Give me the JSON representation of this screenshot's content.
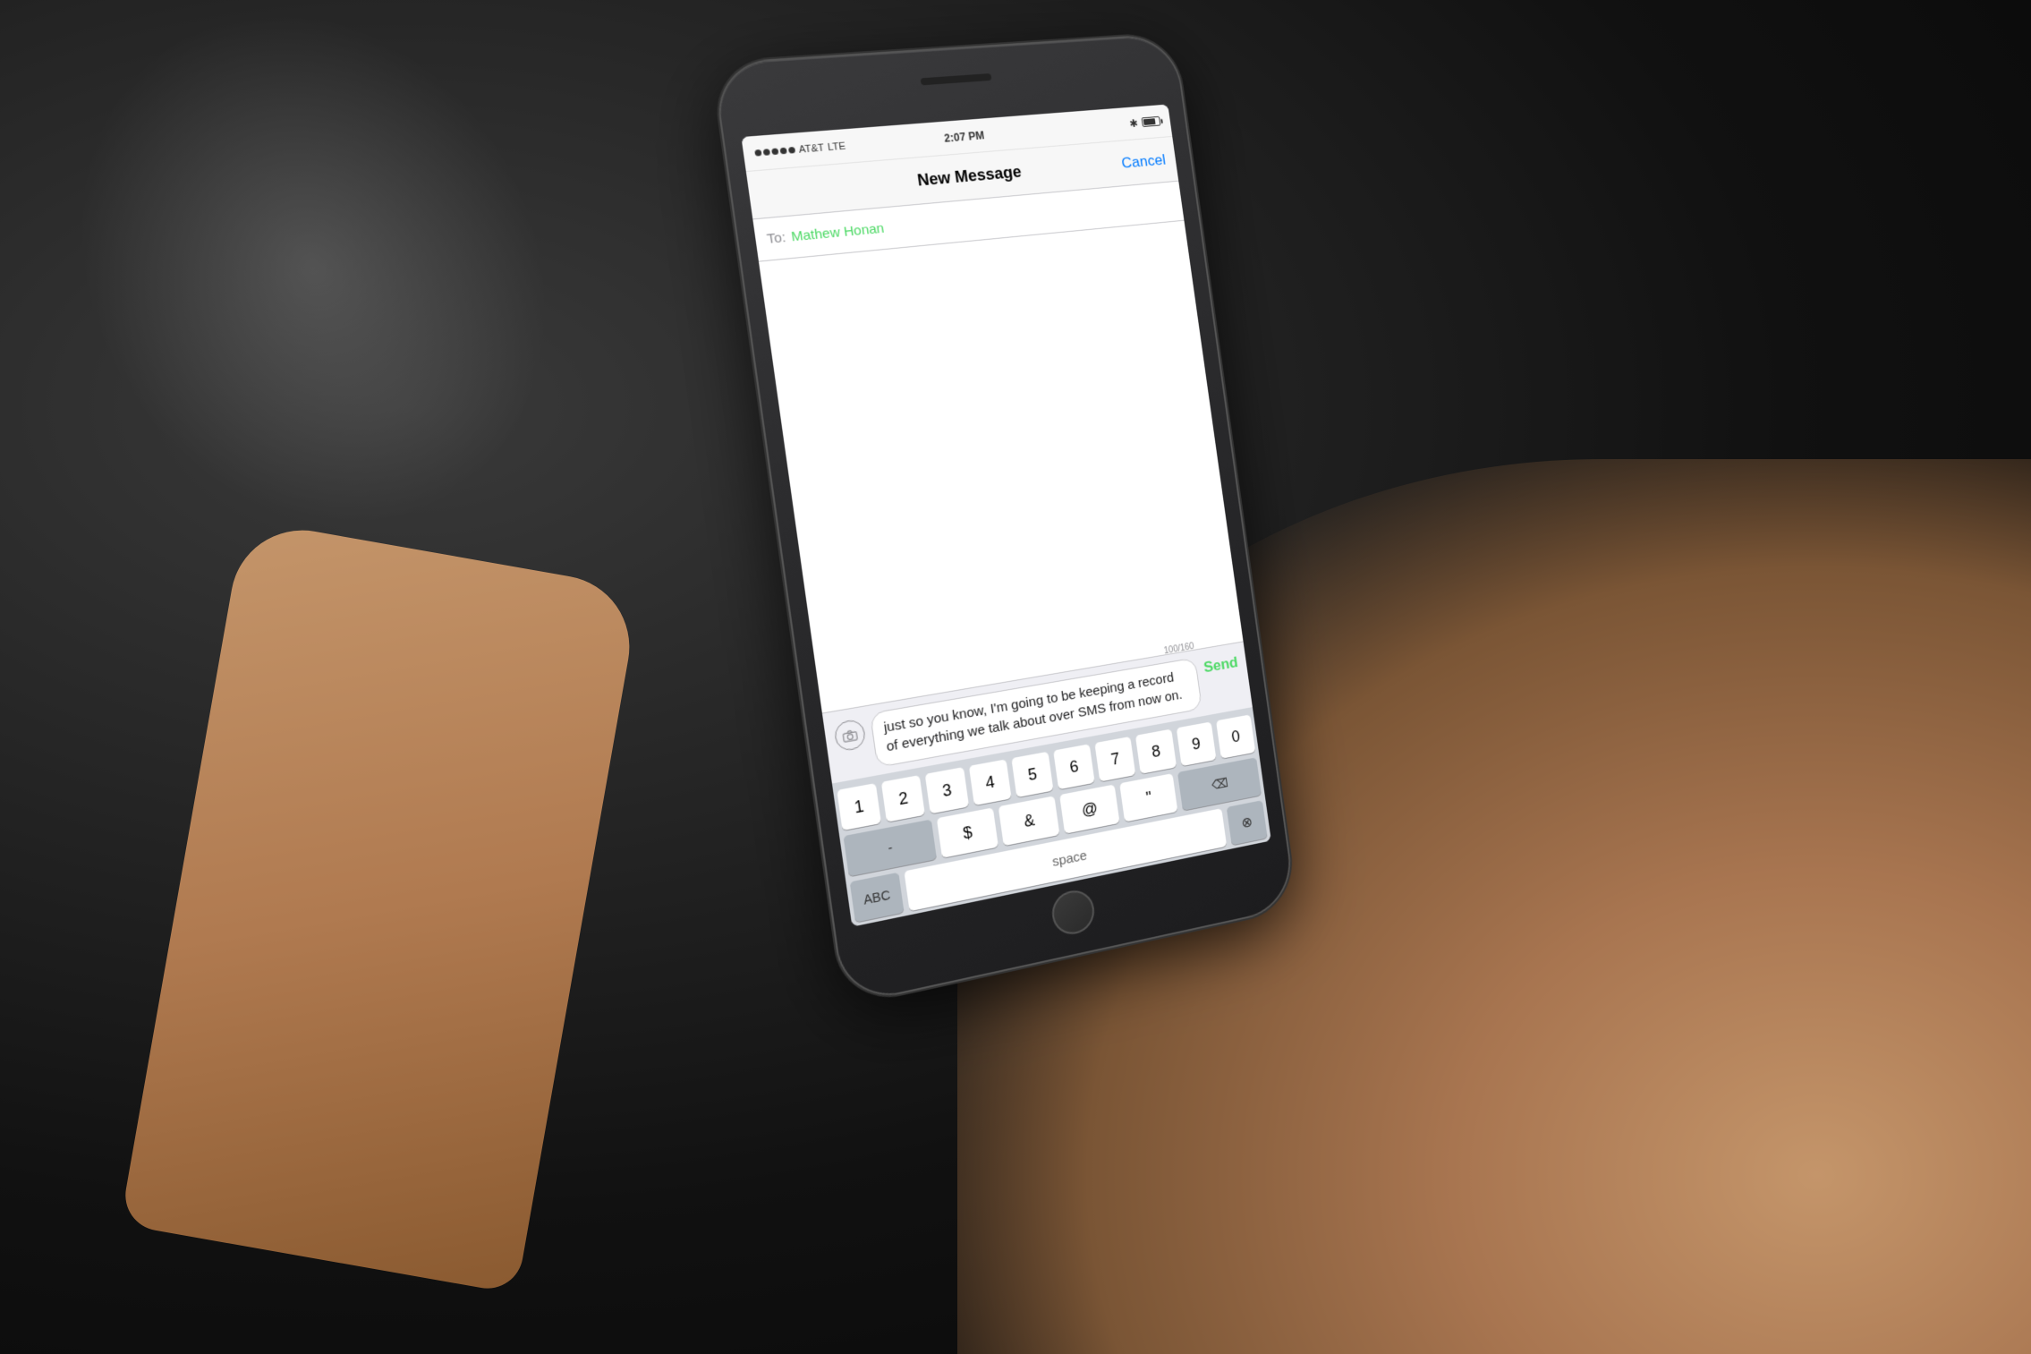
{
  "background": {
    "color_left": "#111111",
    "color_right": "#8a6040"
  },
  "status_bar": {
    "carrier": "AT&T",
    "network": "LTE",
    "time": "2:07 PM",
    "battery_level": "80"
  },
  "nav_bar": {
    "title": "New Message",
    "cancel_label": "Cancel"
  },
  "to_field": {
    "label": "To:",
    "recipient": "Mathew Honan"
  },
  "message": {
    "text": "just so you know, I'm going to be keeping a record of everything we talk about over SMS from now on.",
    "char_count": "100/160",
    "send_label": "Send"
  },
  "keyboard": {
    "row1": [
      "1",
      "2",
      "3",
      "4",
      "5",
      "6",
      "7",
      "8",
      "9",
      "0"
    ],
    "row2": [
      "-",
      "$",
      "&",
      "@",
      "\""
    ],
    "bottom": {
      "abc_label": "ABC",
      "space_label": "space"
    }
  },
  "icons": {
    "camera": "camera-icon",
    "bluetooth": "✱",
    "delete": "⌫"
  }
}
